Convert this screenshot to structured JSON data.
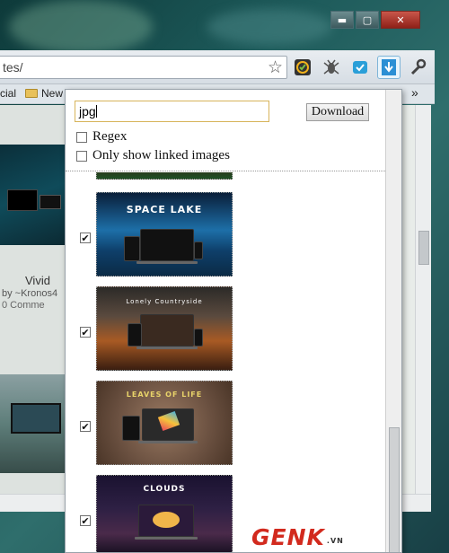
{
  "window": {
    "minimize_glyph": "▬",
    "maximize_glyph": "▢",
    "close_glyph": "✕"
  },
  "toolbar": {
    "url_text": "tes/",
    "star_icon": "star-icon",
    "extensions": [
      "google-analytics-icon",
      "bug-icon",
      "check-icon",
      "download-arrow-icon",
      "wrench-icon"
    ]
  },
  "bookmarks": {
    "items": [
      "cial",
      "New"
    ],
    "overflow_glyph": "»"
  },
  "page": {
    "item_title": "Vivid",
    "item_by": "by ~Kronos4",
    "item_comments": "0 Comme"
  },
  "popup": {
    "filter_value": "jpg",
    "download_label": "Download",
    "regex_label": "Regex",
    "regex_checked": false,
    "linked_label": "Only show linked images",
    "linked_checked": false,
    "images": [
      {
        "label": "SPACE LAKE",
        "checked": true,
        "colors": [
          "#0a1f3a",
          "#1d6fa8",
          "#0b2b46"
        ]
      },
      {
        "label": "Lonely Countryside",
        "checked": true,
        "colors": [
          "#3a2b22",
          "#a85a24",
          "#2c1a12"
        ]
      },
      {
        "label": "LEAVES OF LIFE",
        "checked": true,
        "colors": [
          "#6a5040",
          "#8b6a52",
          "#4a3527"
        ]
      },
      {
        "label": "CLOUDS",
        "checked": true,
        "colors": [
          "#1a1230",
          "#4a2a4a",
          "#0b0a18"
        ]
      }
    ],
    "check_glyph": "✔"
  },
  "watermark": {
    "brand": "GENK",
    "suffix": ".VN"
  }
}
